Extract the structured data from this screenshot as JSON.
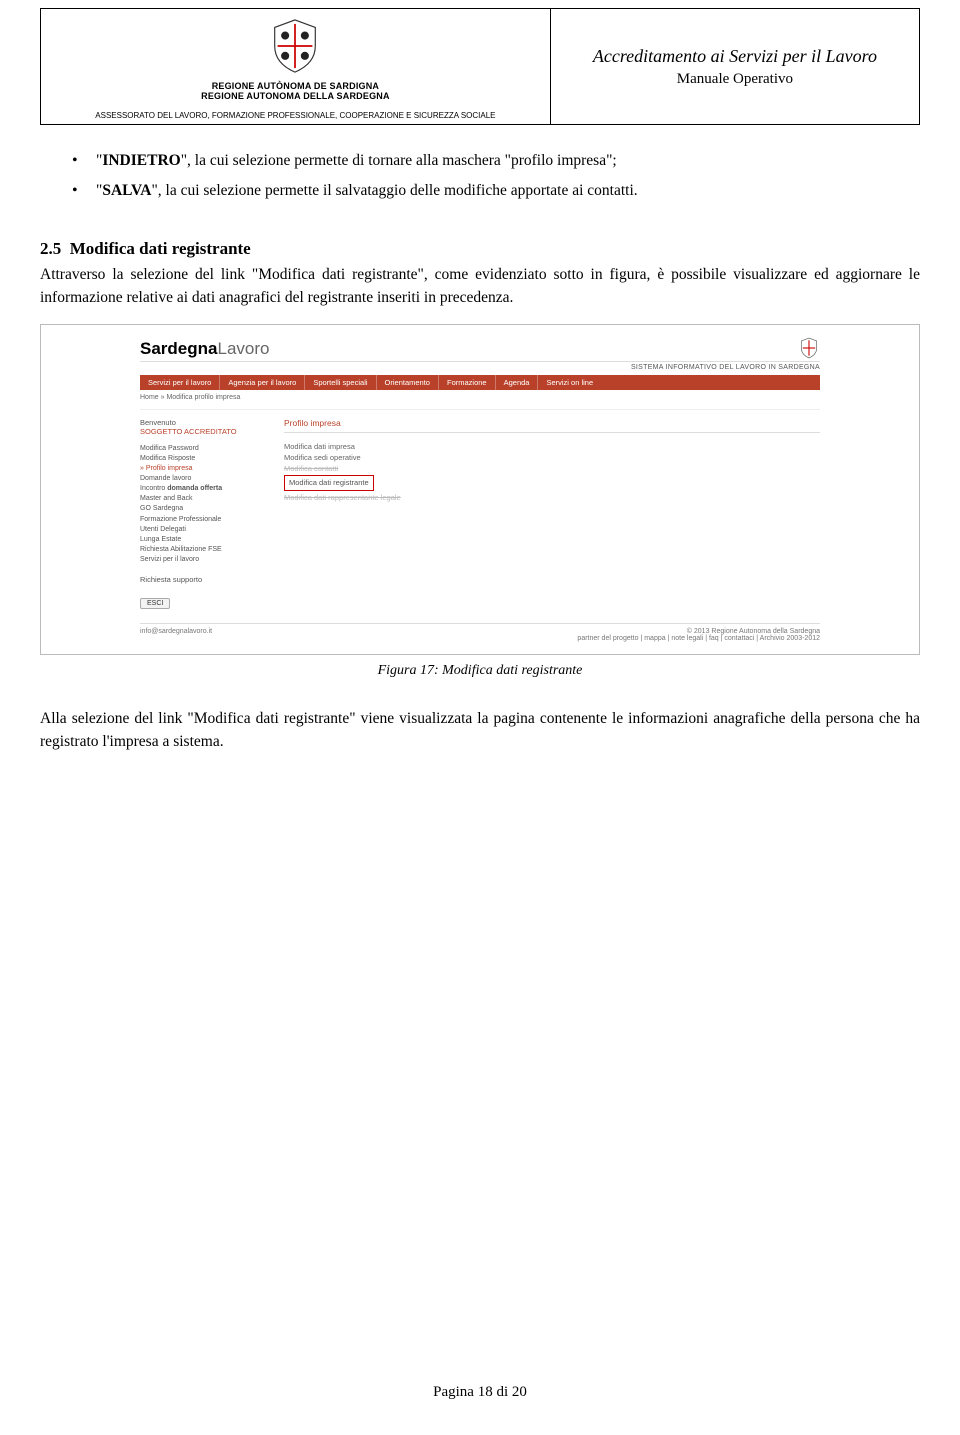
{
  "header": {
    "region_line1": "REGIONE AUTÒNOMA DE SARDIGNA",
    "region_line2": "REGIONE AUTONOMA DELLA SARDEGNA",
    "department": "ASSESSORATO DEL LAVORO, FORMAZIONE PROFESSIONALE, COOPERAZIONE E SICUREZZA SOCIALE",
    "doc_title": "Accreditamento ai Servizi per il Lavoro",
    "doc_subtitle": "Manuale Operativo"
  },
  "bullets": {
    "b1_strong": "INDIETRO",
    "b1_rest": "\", la cui selezione permette di tornare alla maschera \"profilo impresa\";",
    "b2_strong": "SALVA",
    "b2_rest": "\", la cui selezione permette il salvataggio delle modifiche apportate ai contatti."
  },
  "section": {
    "num": "2.5",
    "title": "Modifica dati registrante",
    "para": "Attraverso la selezione del link \"Modifica dati registrante\", come evidenziato sotto in figura, è possibile visualizzare ed aggiornare le informazione relative ai dati anagrafici del registrante inseriti in precedenza."
  },
  "screenshot": {
    "brand_bold": "Sardegna",
    "brand_light": "Lavoro",
    "tagline": "SISTEMA INFORMATIVO DEL LAVORO IN SARDEGNA",
    "nav": [
      "Servizi per il lavoro",
      "Agenzia per il lavoro",
      "Sportelli speciali",
      "Orientamento",
      "Formazione",
      "Agenda",
      "Servizi on line"
    ],
    "crumb": "Home » Modifica profilo impresa",
    "side": {
      "welcome": "Benvenuto",
      "user": "SOGGETTO ACCREDITATO",
      "links": [
        "Modifica Password",
        "Modifica Risposte",
        "» Profilo impresa",
        "Domande lavoro",
        "Incontro domanda offerta",
        "Master and Back",
        "GO Sardegna",
        "Formazione Professionale",
        "Utenti Delegati",
        "Lunga Estate",
        "Richiesta Abilitazione FSE",
        "Servizi per il lavoro"
      ],
      "support": "Richiesta supporto",
      "exit": "ESCI"
    },
    "main": {
      "panel_title": "Profilo impresa",
      "links": [
        "Modifica dati impresa",
        "Modifica sedi operative",
        "Modifica contatti",
        "Modifica dati registrante",
        "Modifica dati rappresentante legale"
      ]
    },
    "footer": {
      "email": "info@sardegnalavoro.it",
      "copyright": "© 2013 Regione Autonoma della Sardegna",
      "links": "partner del progetto | mappa | note legali | faq | contattaci | Archivio 2003-2012"
    }
  },
  "caption": "Figura 17: Modifica dati registrante",
  "para2": "Alla selezione del link \"Modifica dati registrante\" viene visualizzata la pagina contenente le informazioni anagrafiche della persona che ha registrato l'impresa a sistema.",
  "page_footer": "Pagina 18 di 20"
}
